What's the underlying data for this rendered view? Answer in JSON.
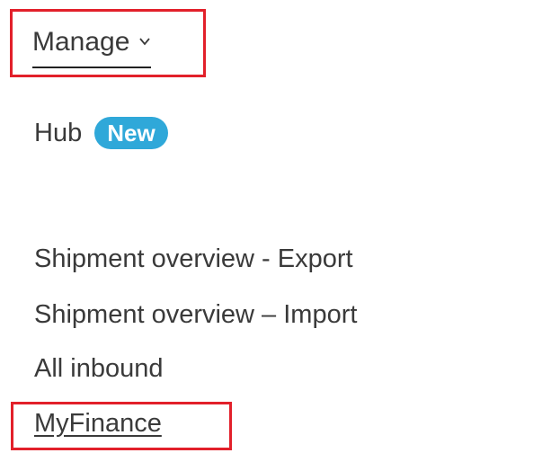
{
  "nav": {
    "manage_label": "Manage",
    "manage_icon": "chevron-down-icon"
  },
  "menu": {
    "hub": {
      "label": "Hub",
      "badge": "New",
      "badge_color": "#2fa8d9"
    },
    "items": [
      "Shipment overview - Export",
      "Shipment overview – Import",
      "All inbound",
      "MyFinance"
    ]
  },
  "highlight_color": "#e2202a"
}
